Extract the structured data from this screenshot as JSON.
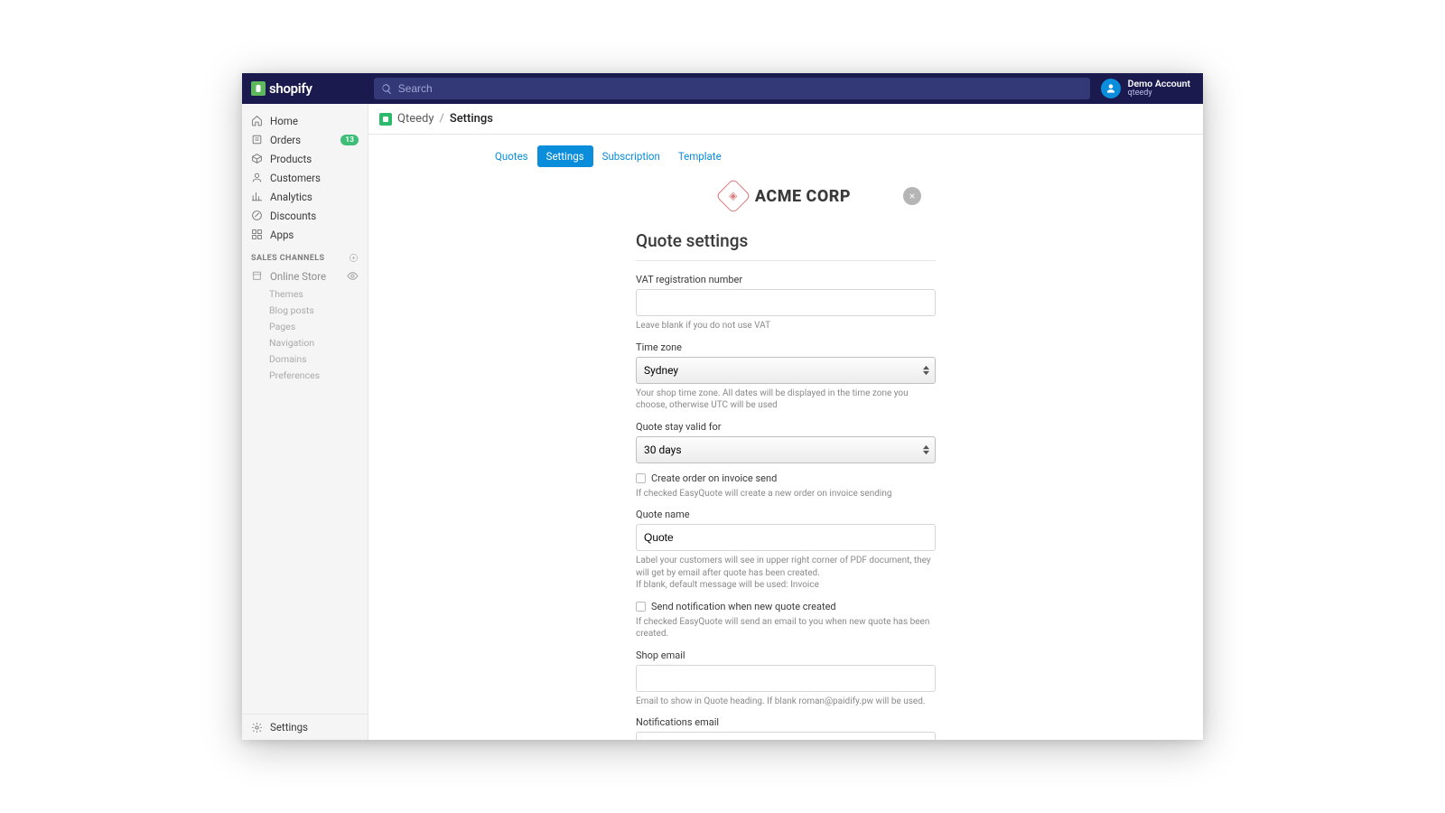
{
  "header": {
    "brand": "shopify",
    "search_placeholder": "Search",
    "user_name": "Demo Account",
    "user_sub": "qteedy"
  },
  "sidebar": {
    "items": [
      {
        "label": "Home",
        "icon": "home"
      },
      {
        "label": "Orders",
        "icon": "orders",
        "badge": "13"
      },
      {
        "label": "Products",
        "icon": "products"
      },
      {
        "label": "Customers",
        "icon": "customers"
      },
      {
        "label": "Analytics",
        "icon": "analytics"
      },
      {
        "label": "Discounts",
        "icon": "discounts"
      },
      {
        "label": "Apps",
        "icon": "apps"
      }
    ],
    "channels_label": "SALES CHANNELS",
    "online_store": "Online Store",
    "sub": [
      "Themes",
      "Blog posts",
      "Pages",
      "Navigation",
      "Domains",
      "Preferences"
    ],
    "settings": "Settings"
  },
  "breadcrumb": {
    "app": "Qteedy",
    "sep": "/",
    "current": "Settings"
  },
  "tabs": [
    "Quotes",
    "Settings",
    "Subscription",
    "Template"
  ],
  "brand_header": {
    "text": "ACME CORP"
  },
  "form": {
    "title": "Quote settings",
    "vat_label": "VAT registration number",
    "vat_value": "",
    "vat_hint": "Leave blank if you do not use VAT",
    "tz_label": "Time zone",
    "tz_value": "Sydney",
    "tz_hint": "Your shop time zone. All dates will be displayed in the time zone you choose, otherwise UTC will be used",
    "valid_label": "Quote stay valid for",
    "valid_value": "30 days",
    "create_order_label": "Create order on invoice send",
    "create_order_hint": "If checked EasyQuote will create a new order on invoice sending",
    "qname_label": "Quote name",
    "qname_value": "Quote",
    "qname_hint1": "Label your customers will see in upper right corner of PDF document, they will get by email after quote has been created.",
    "qname_hint2": "If blank, default message will be used: Invoice",
    "notify_label": "Send notification when new quote created",
    "notify_hint": "If checked EasyQuote will send an email to you when new quote has been created.",
    "shopemail_label": "Shop email",
    "shopemail_value": "",
    "shopemail_hint": "Email to show in Quote heading. If blank roman@paidify.pw will be used.",
    "notifemail_label": "Notifications email",
    "notifemail_value": ""
  }
}
